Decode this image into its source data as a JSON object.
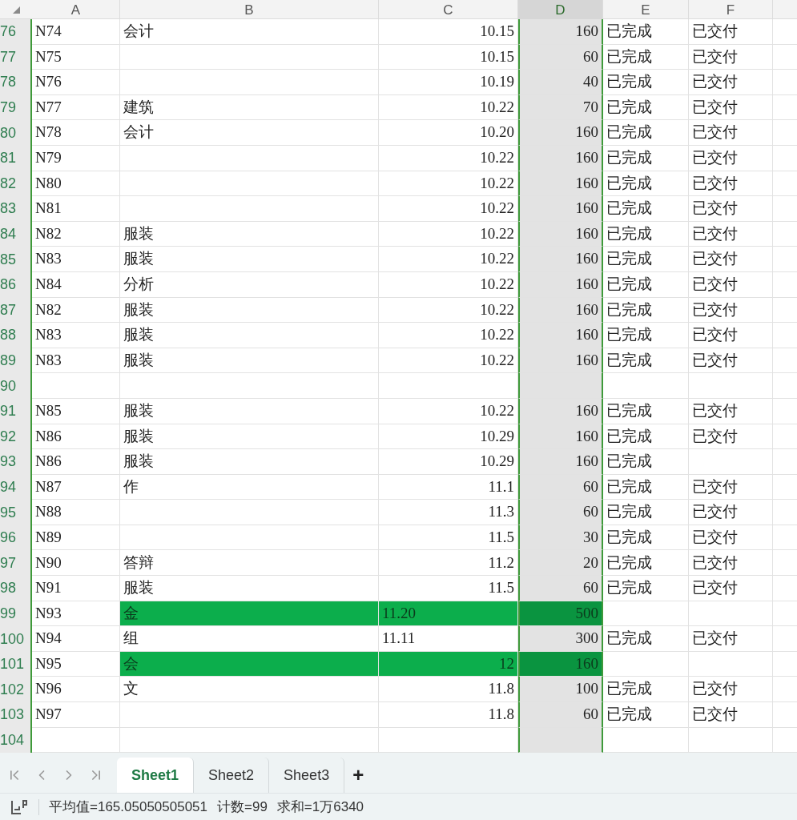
{
  "columns": [
    {
      "label": "A",
      "selected": false
    },
    {
      "label": "B",
      "selected": false
    },
    {
      "label": "C",
      "selected": false
    },
    {
      "label": "D",
      "selected": true
    },
    {
      "label": "E",
      "selected": false
    },
    {
      "label": "F",
      "selected": false
    }
  ],
  "rows": [
    {
      "num": "76",
      "a": "N74",
      "b": "会计",
      "c": "10.15",
      "d": "160",
      "e": "已完成",
      "f": "已交付",
      "highlighted": false,
      "c_left": false
    },
    {
      "num": "77",
      "a": "N75",
      "c": "10.15",
      "d": "60",
      "e": "已完成",
      "f": "已交付",
      "highlighted": false,
      "c_left": false
    },
    {
      "num": "78",
      "a": "N76",
      "c": "10.19",
      "d": "40",
      "e": "已完成",
      "f": "已交付",
      "highlighted": false,
      "c_left": false
    },
    {
      "num": "79",
      "a": "N77",
      "b": "建筑",
      "c": "10.22",
      "d": "70",
      "e": "已完成",
      "f": "已交付",
      "highlighted": false,
      "c_left": false
    },
    {
      "num": "80",
      "a": "N78",
      "b": "会计",
      "c": "10.20",
      "d": "160",
      "e": "已完成",
      "f": "已交付",
      "highlighted": false,
      "c_left": false
    },
    {
      "num": "81",
      "a": "N79",
      "c": "10.22",
      "d": "160",
      "e": "已完成",
      "f": "已交付",
      "highlighted": false,
      "c_left": false
    },
    {
      "num": "82",
      "a": "N80",
      "c": "10.22",
      "d": "160",
      "e": "已完成",
      "f": "已交付",
      "highlighted": false,
      "c_left": false
    },
    {
      "num": "83",
      "a": "N81",
      "c": "10.22",
      "d": "160",
      "e": "已完成",
      "f": "已交付",
      "highlighted": false,
      "c_left": false
    },
    {
      "num": "84",
      "a": "N82",
      "b": "服装",
      "c": "10.22",
      "d": "160",
      "e": "已完成",
      "f": "已交付",
      "highlighted": false,
      "c_left": false
    },
    {
      "num": "85",
      "a": "N83",
      "b": "服装",
      "c": "10.22",
      "d": "160",
      "e": "已完成",
      "f": "已交付",
      "highlighted": false,
      "c_left": false
    },
    {
      "num": "86",
      "a": "N84",
      "b": "分析",
      "c": "10.22",
      "d": "160",
      "e": "已完成",
      "f": "已交付",
      "highlighted": false,
      "c_left": false
    },
    {
      "num": "87",
      "a": "N82",
      "b": "服装",
      "c": "10.22",
      "d": "160",
      "e": "已完成",
      "f": "已交付",
      "highlighted": false,
      "c_left": false
    },
    {
      "num": "88",
      "a": "N83",
      "b": "服装",
      "c": "10.22",
      "d": "160",
      "e": "已完成",
      "f": "已交付",
      "highlighted": false,
      "c_left": false
    },
    {
      "num": "89",
      "a": "N83",
      "b": "服装",
      "c": "10.22",
      "d": "160",
      "e": "已完成",
      "f": "已交付",
      "highlighted": false,
      "c_left": false
    },
    {
      "num": "90",
      "highlighted": false
    },
    {
      "num": "91",
      "a": "N85",
      "b": "服装",
      "c": "10.22",
      "d": "160",
      "e": "已完成",
      "f": "已交付",
      "highlighted": false,
      "c_left": false
    },
    {
      "num": "92",
      "a": "N86",
      "b": "服装",
      "c": "10.29",
      "d": "160",
      "e": "已完成",
      "f": "已交付",
      "highlighted": false,
      "c_left": false
    },
    {
      "num": "93",
      "a": "N86",
      "b": "服装",
      "c": "10.29",
      "d": "160",
      "e": "已完成",
      "highlighted": false,
      "c_left": false
    },
    {
      "num": "94",
      "a": "N87",
      "b": "作",
      "c": "11.1",
      "d": "60",
      "e": "已完成",
      "f": "已交付",
      "highlighted": false,
      "c_left": false
    },
    {
      "num": "95",
      "a": "N88",
      "c": "11.3",
      "d": "60",
      "e": "已完成",
      "f": "已交付",
      "highlighted": false,
      "c_left": false
    },
    {
      "num": "96",
      "a": "N89",
      "c": "11.5",
      "d": "30",
      "e": "已完成",
      "f": "已交付",
      "highlighted": false,
      "c_left": false
    },
    {
      "num": "97",
      "a": "N90",
      "b": "答辩",
      "c": "11.2",
      "d": "20",
      "e": "已完成",
      "f": "已交付",
      "highlighted": false,
      "c_left": false
    },
    {
      "num": "98",
      "a": "N91",
      "b": "服装",
      "c": "11.5",
      "d": "60",
      "e": "已完成",
      "f": "已交付",
      "highlighted": false,
      "c_left": false
    },
    {
      "num": "99",
      "a": "N93",
      "b": "金",
      "c": "11.20",
      "d": "500",
      "highlighted": true,
      "c_left": true
    },
    {
      "num": "100",
      "a": "N94",
      "b": "组",
      "c": "11.11",
      "d": "300",
      "e": "已完成",
      "f": "已交付",
      "highlighted": false,
      "c_left": true
    },
    {
      "num": "101",
      "a": "N95",
      "b": "会",
      "c": "12",
      "d": "160",
      "highlighted": true,
      "c_left": false
    },
    {
      "num": "102",
      "a": "N96",
      "b": "文",
      "c": "11.8",
      "d": "100",
      "e": "已完成",
      "f": "已交付",
      "highlighted": false,
      "c_left": false
    },
    {
      "num": "103",
      "a": "N97",
      "c": "11.8",
      "d": "60",
      "e": "已完成",
      "f": "已交付",
      "highlighted": false,
      "c_left": false
    },
    {
      "num": "104",
      "highlighted": false
    }
  ],
  "sheet_tabs": [
    {
      "label": "Sheet1",
      "selected": true
    },
    {
      "label": "Sheet2",
      "selected": false
    },
    {
      "label": "Sheet3",
      "selected": false
    }
  ],
  "add_sheet": "+",
  "status_bar": {
    "average": "平均值=165.05050505051",
    "count": "计数=99",
    "sum": "求和=1万6340"
  }
}
